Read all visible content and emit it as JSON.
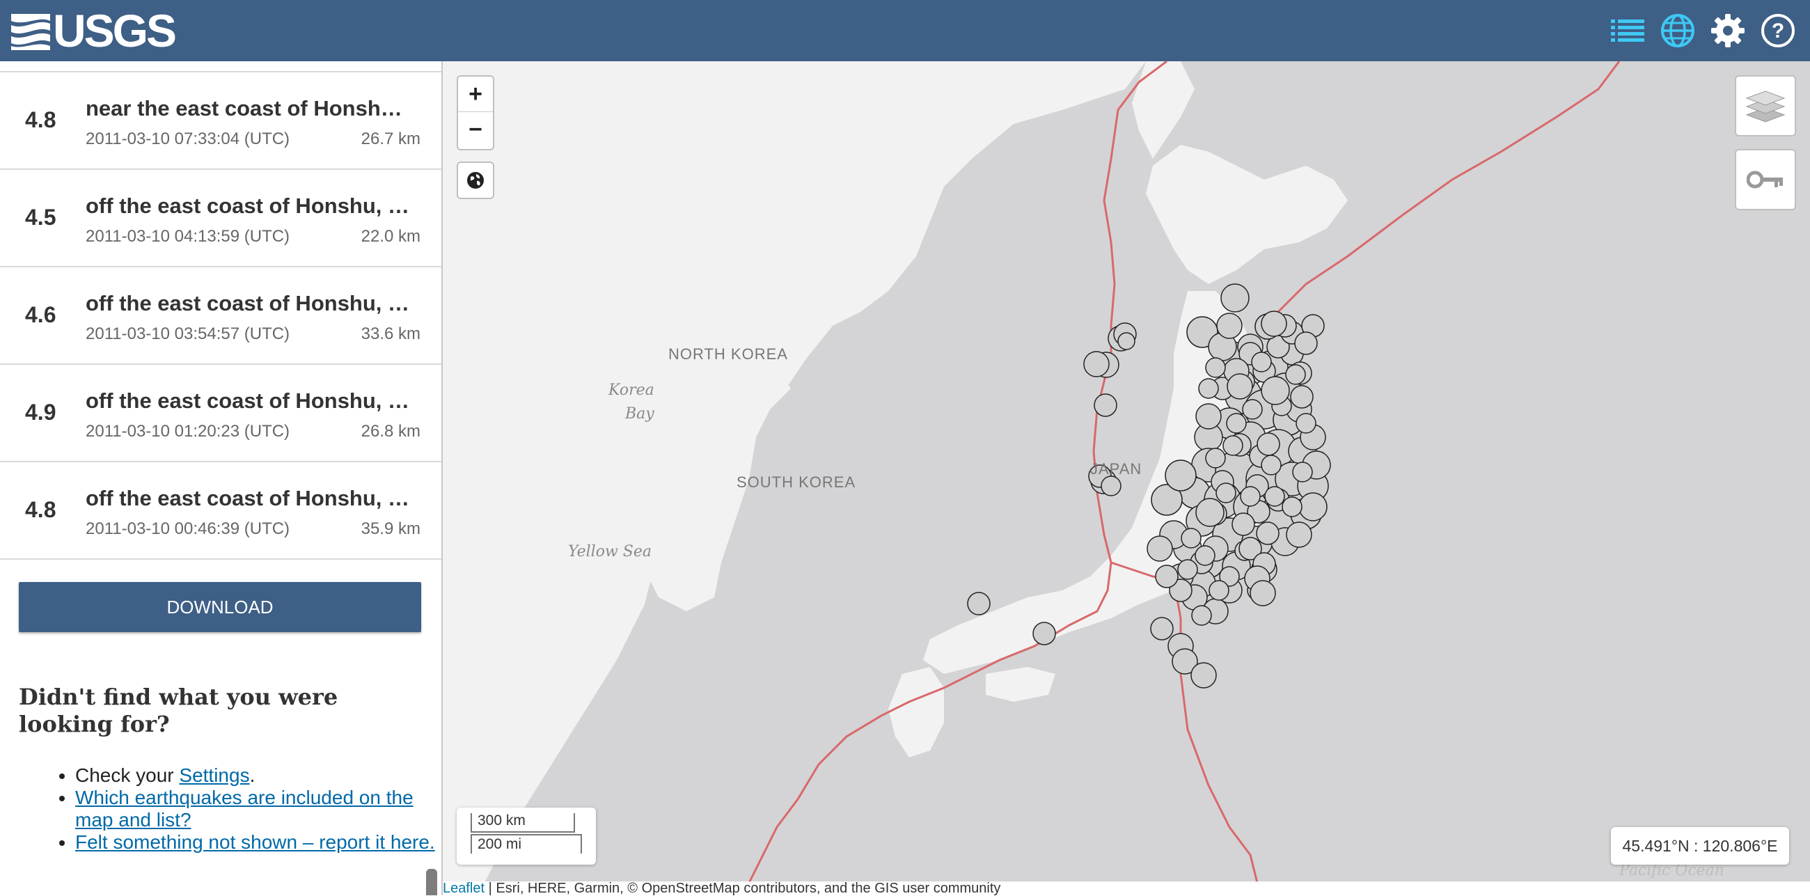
{
  "header": {
    "logo_text": "USGS",
    "icons": [
      "list-icon",
      "globe-icon",
      "gear-icon",
      "help-icon"
    ],
    "background_color": "#3e5f86",
    "active_icon_color": "#3ec9f3"
  },
  "earthquakes": [
    {
      "mag": "4.8",
      "title": "near the east coast of Honshu, Japan",
      "time": "2011-03-10 07:33:04 (UTC)",
      "depth": "26.7 km"
    },
    {
      "mag": "4.5",
      "title": "off the east coast of Honshu, Japan",
      "time": "2011-03-10 04:13:59 (UTC)",
      "depth": "22.0 km"
    },
    {
      "mag": "4.6",
      "title": "off the east coast of Honshu, Japan",
      "time": "2011-03-10 03:54:57 (UTC)",
      "depth": "33.6 km"
    },
    {
      "mag": "4.9",
      "title": "off the east coast of Honshu, Japan",
      "time": "2011-03-10 01:20:23 (UTC)",
      "depth": "26.8 km"
    },
    {
      "mag": "4.8",
      "title": "off the east coast of Honshu, Japan",
      "time": "2011-03-10 00:46:39 (UTC)",
      "depth": "35.9 km"
    }
  ],
  "download_label": "DOWNLOAD",
  "help": {
    "title": "Didn't find what you were looking for?",
    "item1_prefix": "Check your ",
    "item1_link": "Settings",
    "item1_suffix": ".",
    "item2_link": "Which earthquakes are included on the map and list?",
    "item3_link": "Felt something not shown – report it here."
  },
  "map": {
    "zoom_in": "+",
    "zoom_out": "−",
    "labels": {
      "north_korea": "NORTH KOREA",
      "south_korea": "SOUTH KOREA",
      "japan": "JAPAN",
      "korea_bay_1": "Korea",
      "korea_bay_2": "Bay",
      "yellow_sea": "Yellow Sea",
      "pacific_ocean": "Pacific Ocean"
    },
    "scale_km": "300 km",
    "scale_mi": "200 mi",
    "coordinates": "45.491°N : 120.806°E",
    "attribution_link": "Leaflet",
    "attribution_text": " | Esri, HERE, Garmin, © OpenStreetMap contributors, and the GIS user community",
    "plate_boundary_color": "#d9686a",
    "land_color": "#f2f2f2",
    "water_color": "#d4d4d6"
  }
}
